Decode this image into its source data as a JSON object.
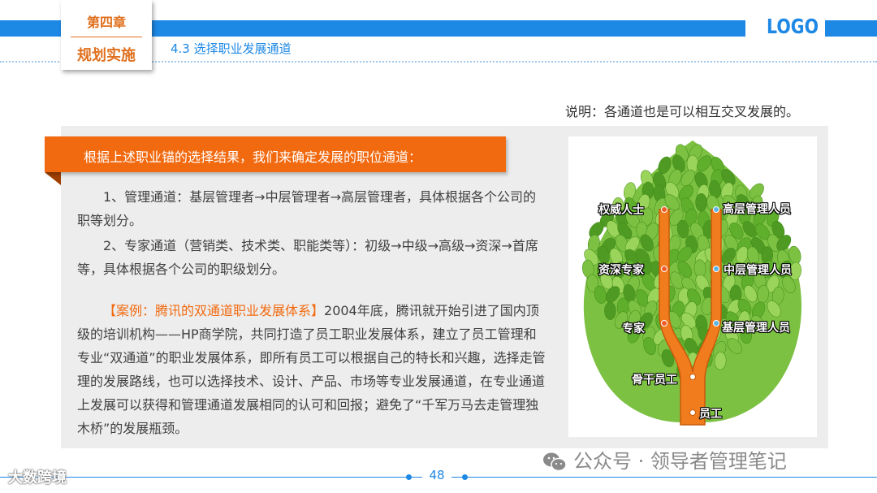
{
  "header": {
    "chapter_label": "第四章",
    "chapter_title": "规划实施",
    "section_title": "4.3 选择职业发展通道",
    "logo": "LOGO"
  },
  "note": "说明：各通道也是可以相互交叉发展的。",
  "banner": {
    "text": "根据上述职业锚的选择结果，我们来确定发展的职位通道："
  },
  "content": {
    "para1": "1、管理通道：基层管理者→中层管理者→高层管理者，具体根据各个公司的职等划分。",
    "para2": "2、专家通道（营销类、技术类、职能类等）：初级→中级→高级→资深→首席等，具体根据各个公司的职级划分。",
    "case_title": "【案例：腾讯的双通道职业发展体系】",
    "case_body": "2004年底，腾讯就开始引进了国内顶级的培训机构——HP商学院，共同打造了员工职业发展体系，建立了员工管理和专业“双通道”的职业发展体系，即所有员工可以根据自己的特长和兴趣，选择走管理的发展路线，也可以选择技术、设计、产品、市场等专业发展通道，在专业通道上发展可以获得和管理通道发展相同的认可和回报；避免了“千军万马去走管理独木桥”的发展瓶颈。"
  },
  "tree": {
    "labels": {
      "authority": "权威人士",
      "senior_expert": "资深专家",
      "expert": "专家",
      "backbone": "骨干员工",
      "employee": "员工",
      "senior_mgmt": "高层管理人员",
      "middle_mgmt": "中层管理人员",
      "junior_mgmt": "基层管理人员"
    },
    "colors": {
      "leaf_green": "#7cc142",
      "leaf_dark": "#4e9a22",
      "trunk_orange": "#f07c1e",
      "node_left": "#f05a28",
      "node_right": "#5ab4e8"
    }
  },
  "footer": {
    "page_number": "48",
    "watermark_left": "大数跨境",
    "watermark_right": "公众号 · 领导者管理笔记"
  }
}
